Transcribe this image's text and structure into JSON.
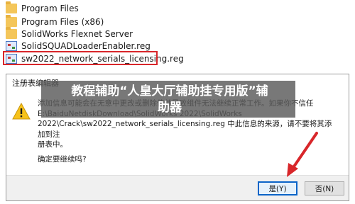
{
  "explorer": {
    "items": [
      {
        "name": "Program Files",
        "type": "folder"
      },
      {
        "name": "Program Files (x86)",
        "type": "folder"
      },
      {
        "name": "SolidWorks Flexnet Server",
        "type": "folder"
      },
      {
        "name": "SolidSQUADLoaderEnabler.reg",
        "type": "reg"
      },
      {
        "name": "sw2022_network_serials_licensing.reg",
        "type": "reg"
      }
    ]
  },
  "dialog": {
    "title": "注册表编辑器",
    "message": "添加信息可能会在无意中更改或删除值并导致组件无法继续正常工作。如果你不信任\nE:\\BaiduNetdiskDownload\\SolidWorks 2022\\SolidWorks\n2022\\Crack\\sw2022_network_serials_licensing.reg 中此信息的来源，请不要将其添加到注\n册表中。",
    "question": "确定要继续吗?",
    "yes_button": "是(Y)",
    "no_button": "否(N)"
  },
  "watermark": {
    "line1": "教程辅助“人皇大厅辅助挂专用版”辅",
    "line2": "助器"
  },
  "colors": {
    "highlight_border": "#d8262a",
    "arrow": "#d8262a",
    "primary_button_border": "#0a64c8"
  }
}
